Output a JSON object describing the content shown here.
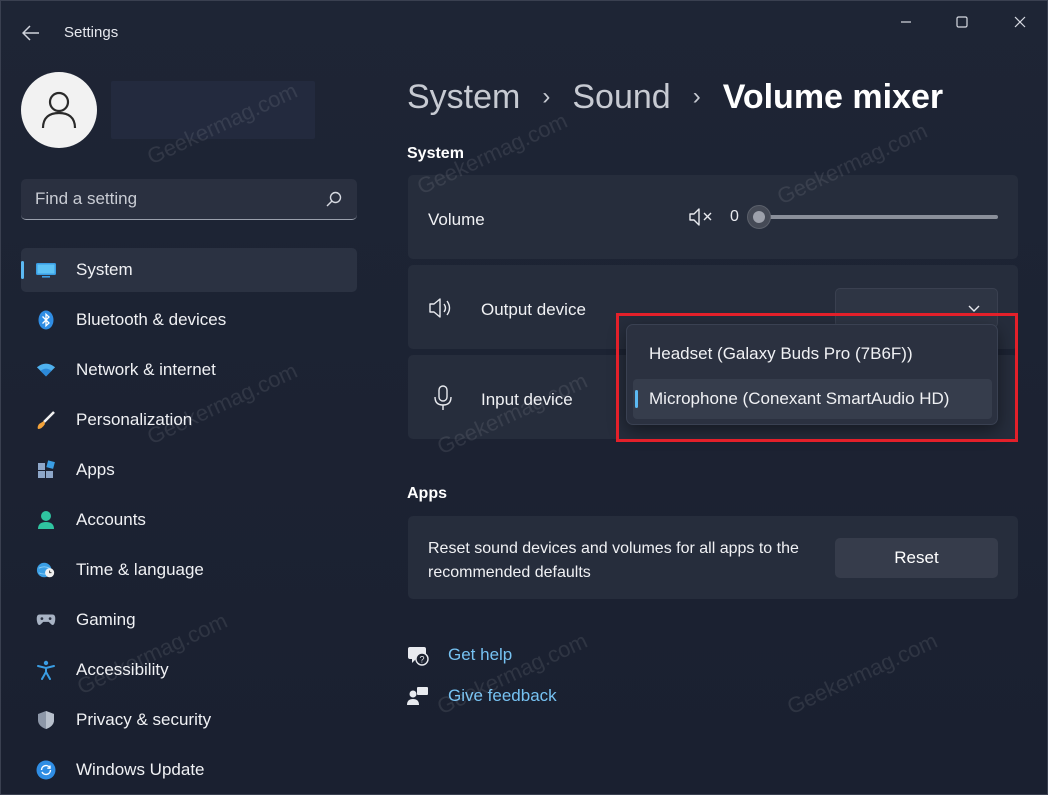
{
  "window": {
    "app_title": "Settings",
    "accent": "#5cb9f2",
    "highlight_color": "#e3202a"
  },
  "search": {
    "placeholder": "Find a setting"
  },
  "nav": {
    "items": [
      {
        "label": "System",
        "icon": "display-icon",
        "active": true
      },
      {
        "label": "Bluetooth & devices",
        "icon": "bluetooth-icon"
      },
      {
        "label": "Network & internet",
        "icon": "wifi-icon"
      },
      {
        "label": "Personalization",
        "icon": "brush-icon"
      },
      {
        "label": "Apps",
        "icon": "apps-icon"
      },
      {
        "label": "Accounts",
        "icon": "person-icon"
      },
      {
        "label": "Time & language",
        "icon": "globe-clock-icon"
      },
      {
        "label": "Gaming",
        "icon": "gamepad-icon"
      },
      {
        "label": "Accessibility",
        "icon": "accessibility-icon"
      },
      {
        "label": "Privacy & security",
        "icon": "shield-icon"
      },
      {
        "label": "Windows Update",
        "icon": "update-icon"
      }
    ]
  },
  "breadcrumb": {
    "items": [
      "System",
      "Sound",
      "Volume mixer"
    ],
    "separator": "›"
  },
  "system_section": {
    "title": "System",
    "volume_label": "Volume",
    "volume_value": "0",
    "output_label": "Output device",
    "input_label": "Input device"
  },
  "dropdown": {
    "options": [
      "Headset (Galaxy Buds Pro (7B6F))",
      "Microphone (Conexant SmartAudio HD)"
    ],
    "selected_index": 1
  },
  "apps_section": {
    "title": "Apps",
    "reset_text": "Reset sound devices and volumes for all apps to the recommended defaults",
    "reset_label": "Reset"
  },
  "help": {
    "get_help": "Get help",
    "give_feedback": "Give feedback"
  },
  "watermark": "Geekermag.com"
}
